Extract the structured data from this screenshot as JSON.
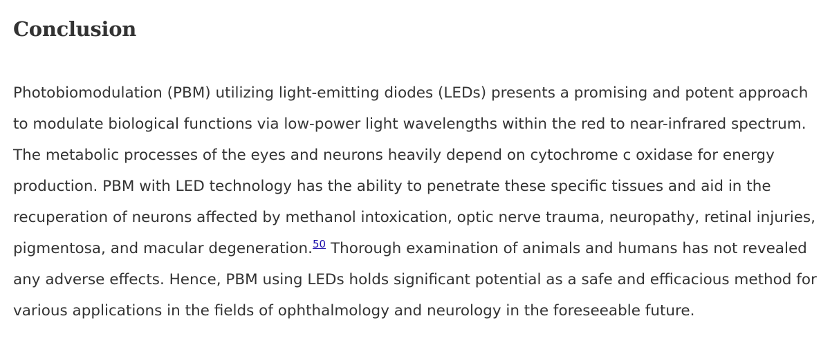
{
  "section": {
    "heading": "Conclusion",
    "paragraph": {
      "text_before_ref": "Photobiomodulation (PBM) utilizing light-emitting diodes (LEDs) presents a promising and potent approach to modulate biological functions via low-power light wavelengths within the red to near-infrared spectrum. The metabolic processes of the eyes and neurons heavily depend on cytochrome c oxidase for energy production. PBM with LED technology has the ability to penetrate these specific tissues and aid in the recuperation of neurons affected by methanol intoxication, optic nerve trauma, neuropathy, retinal injuries, pigmentosa, and macular degeneration.",
      "reference": "50",
      "text_after_ref": " Thorough examination of animals and humans has not revealed any adverse effects. Hence, PBM using LEDs holds significant potential as a safe and efficacious method for various applications in the fields of ophthalmology and neurology in the foreseeable future."
    }
  },
  "colors": {
    "text": "#333333",
    "link": "#1a0dab",
    "background": "#ffffff"
  }
}
